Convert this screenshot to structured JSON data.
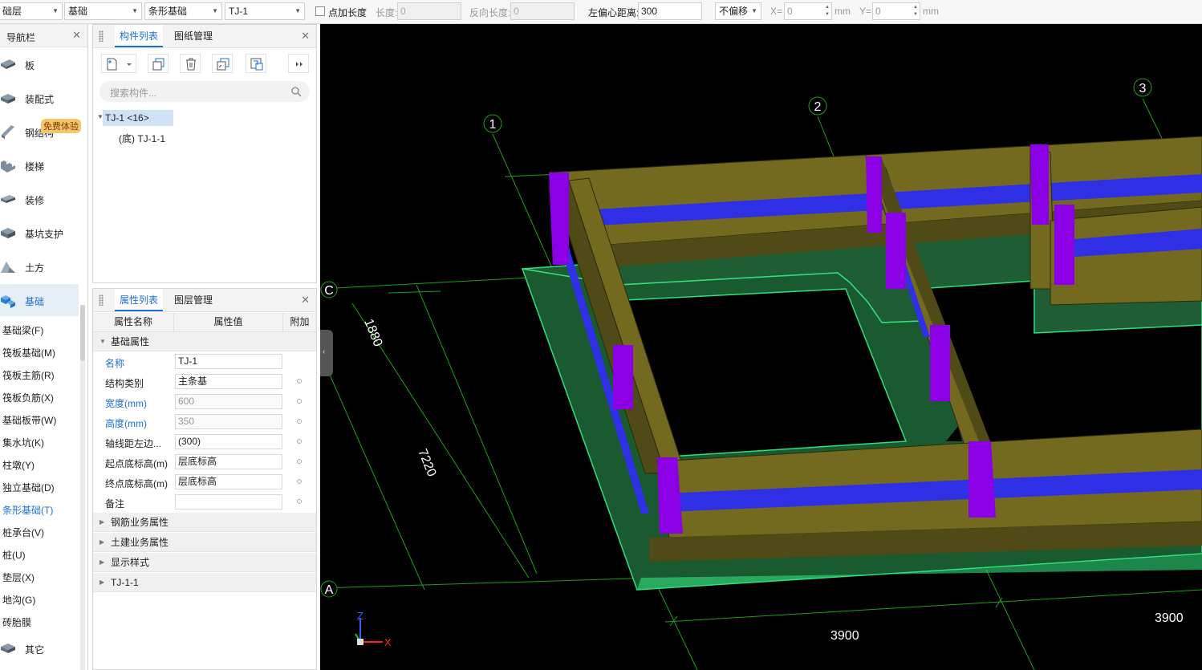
{
  "toolbar": {
    "floor": "础层",
    "category": "基础",
    "type": "条形基础",
    "component": "TJ-1",
    "point_length_label": "点加长度",
    "length_label": "长度:",
    "length_value": "0",
    "reverse_length_label": "反向长度:",
    "reverse_length_value": "0",
    "left_offset_label": "左偏心距离:",
    "left_offset_value": "300",
    "offset_mode": "不偏移",
    "x_label": "X=",
    "x_value": "0",
    "x_unit": "mm",
    "y_label": "Y=",
    "y_value": "0",
    "y_unit": "mm"
  },
  "nav": {
    "title": "导航栏",
    "items": [
      {
        "label": "板",
        "icon": "slab-icon"
      },
      {
        "label": "装配式",
        "icon": "prefab-icon"
      },
      {
        "label": "钢结构",
        "icon": "steel-icon"
      },
      {
        "label": "楼梯",
        "icon": "stairs-icon"
      },
      {
        "label": "装修",
        "icon": "decoration-icon"
      },
      {
        "label": "基坑支护",
        "icon": "pit-support-icon"
      },
      {
        "label": "土方",
        "icon": "earthwork-icon"
      },
      {
        "label": "基础",
        "icon": "foundation-icon"
      }
    ],
    "badge": "免费体验",
    "sub_items": [
      "基础梁(F)",
      "筏板基础(M)",
      "筏板主筋(R)",
      "筏板负筋(X)",
      "基础板带(W)",
      "集水坑(K)",
      "柱墩(Y)",
      "独立基础(D)",
      "条形基础(T)",
      "桩承台(V)",
      "桩(U)",
      "垫层(X)",
      "地沟(G)",
      "砖胎膜"
    ],
    "other": "其它"
  },
  "component_panel": {
    "tab_active": "构件列表",
    "tab_other": "图纸管理",
    "search_placeholder": "搜索构件...",
    "tree_parent": "TJ-1 <16>",
    "tree_child": "(底) TJ-1-1"
  },
  "property_panel": {
    "tab_active": "属性列表",
    "tab_other": "图层管理",
    "col_name": "属性名称",
    "col_value": "属性值",
    "col_extra": "附加",
    "group_main": "基础属性",
    "rows": [
      {
        "name": "名称",
        "value": "TJ-1"
      },
      {
        "name": "结构类别",
        "value": "主条基"
      },
      {
        "name": "宽度(mm)",
        "value": "600"
      },
      {
        "name": "高度(mm)",
        "value": "350"
      },
      {
        "name": "轴线距左边...",
        "value": "(300)"
      },
      {
        "name": "起点底标高(m)",
        "value": "层底标高"
      },
      {
        "name": "终点底标高(m)",
        "value": "层底标高"
      },
      {
        "name": "备注",
        "value": ""
      }
    ],
    "groups": [
      "钢筋业务属性",
      "土建业务属性",
      "显示样式",
      "TJ-1-1"
    ]
  },
  "viewport": {
    "axis_labels": [
      "1",
      "2",
      "3",
      "C",
      "A"
    ],
    "dimensions": [
      "1880",
      "7220",
      "3900",
      "3900"
    ],
    "axis_x": "X",
    "axis_z": "Z"
  },
  "colors": {
    "accent": "#1d6fd4",
    "beam_top": "#736a1f",
    "beam_side": "#4f4a16",
    "rebar": "#2f2fe6",
    "column": "#8c00e6",
    "base_top": "#246b3c",
    "base_side": "#1a5a31",
    "outline": "#31e07c",
    "grid": "#1ea01e"
  }
}
